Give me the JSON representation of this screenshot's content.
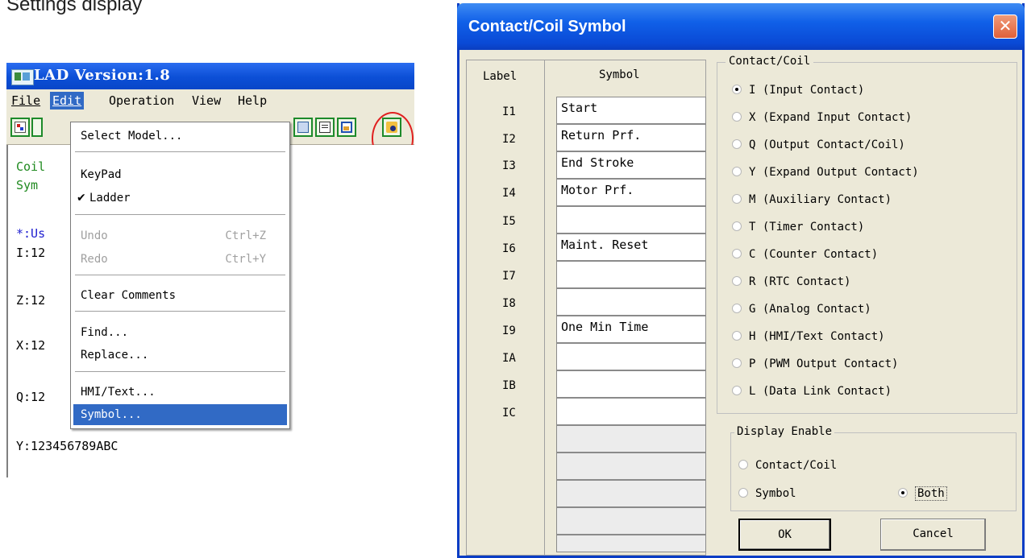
{
  "page_text": "Settings display",
  "lad_window": {
    "title": "LAD Version:1.8",
    "menubar": [
      "File",
      "Edit",
      "Operation",
      "View",
      "Help"
    ],
    "content_lines": [
      {
        "text": "Coil",
        "color": "green"
      },
      {
        "text": "Sym",
        "color": "green"
      },
      {
        "text": "*:Us",
        "color": "blue"
      },
      {
        "text": "I:12",
        "color": "black"
      },
      {
        "text": "Z:12",
        "color": "black"
      },
      {
        "text": "X:12",
        "color": "black"
      },
      {
        "text": "Q:12",
        "color": "black"
      },
      {
        "text": "Y:123456789ABC",
        "color": "black"
      }
    ],
    "edit_menu": {
      "select_model": "Select Model...",
      "keypad": "KeyPad",
      "ladder": "Ladder",
      "undo": "Undo",
      "undo_shortcut": "Ctrl+Z",
      "redo": "Redo",
      "redo_shortcut": "Ctrl+Y",
      "clear_comments": "Clear Comments",
      "find": "Find...",
      "replace": "Replace...",
      "hmi_text": "HMI/Text...",
      "symbol": "Symbol..."
    }
  },
  "dialog": {
    "title": "Contact/Coil Symbol",
    "close_glyph": "✕",
    "label_header": "Label",
    "symbol_header": "Symbol",
    "rows": [
      {
        "label": "I1",
        "symbol": "Start"
      },
      {
        "label": "I2",
        "symbol": "Return Prf."
      },
      {
        "label": "I3",
        "symbol": "End Stroke"
      },
      {
        "label": "I4",
        "symbol": "Motor Prf."
      },
      {
        "label": "I5",
        "symbol": ""
      },
      {
        "label": "I6",
        "symbol": "Maint. Reset"
      },
      {
        "label": "I7",
        "symbol": ""
      },
      {
        "label": "I8",
        "symbol": ""
      },
      {
        "label": "I9",
        "symbol": "One Min Time"
      },
      {
        "label": "IA",
        "symbol": ""
      },
      {
        "label": "IB",
        "symbol": ""
      },
      {
        "label": "IC",
        "symbol": ""
      }
    ],
    "contact_coil": {
      "legend": "Contact/Coil",
      "selected": "I (Input Contact)",
      "options": [
        "I (Input Contact)",
        "X (Expand Input Contact)",
        "Q (Output Contact/Coil)",
        "Y (Expand Output Contact)",
        "M (Auxiliary Contact)",
        "T (Timer Contact)",
        "C (Counter Contact)",
        "R (RTC Contact)",
        "G (Analog Contact)",
        "H (HMI/Text Contact)",
        "P (PWM Output Contact)",
        "L (Data Link Contact)"
      ]
    },
    "display_enable": {
      "legend": "Display Enable",
      "contact_coil": "Contact/Coil",
      "symbol": "Symbol",
      "both": "Both",
      "selected": "Both"
    },
    "ok_label": "OK",
    "cancel_label": "Cancel"
  }
}
